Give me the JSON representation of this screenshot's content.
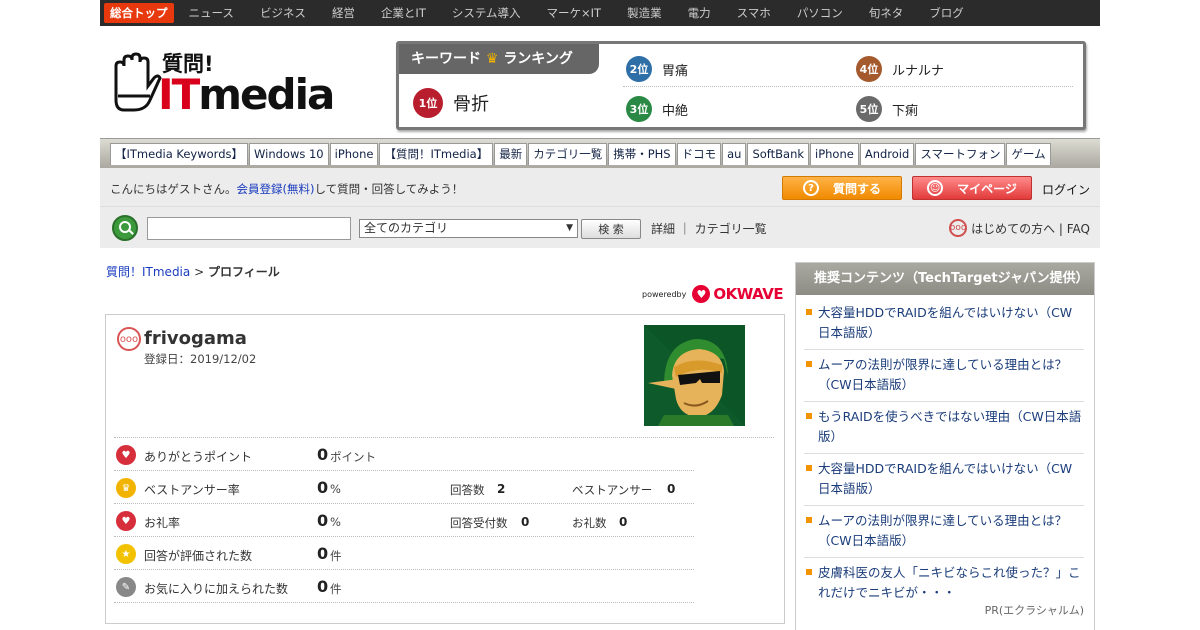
{
  "topnav": {
    "items": [
      "総合トップ",
      "ニュース",
      "ビジネス",
      "経営",
      "企業とIT",
      "システム導入",
      "マーケ×IT",
      "製造業",
      "電力",
      "スマホ",
      "パソコン",
      "旬ネタ",
      "ブログ"
    ]
  },
  "header": {
    "logo_sub": "質問!",
    "logo_it": "IT",
    "logo_media": "media"
  },
  "ranking": {
    "title": "キーワード",
    "crown": "♛",
    "title2": "ランキング",
    "items": [
      {
        "badge": "1位",
        "word": "骨折"
      },
      {
        "badge": "2位",
        "word": "胃痛"
      },
      {
        "badge": "3位",
        "word": "中絶"
      },
      {
        "badge": "4位",
        "word": "ルナルナ"
      },
      {
        "badge": "5位",
        "word": "下痢"
      }
    ]
  },
  "keywords": [
    "【ITmedia Keywords】",
    "Windows 10",
    "iPhone",
    "【質問！ITmedia】",
    "最新",
    "カテゴリ一覧",
    "携帯・PHS",
    "ドコモ",
    "au",
    "SoftBank",
    "iPhone",
    "Android",
    "スマートフォン",
    "ゲーム"
  ],
  "welcome": {
    "pre": "こんにちはゲストさん。",
    "link": "会員登録(無料)",
    "post": "して質問・回答してみよう！",
    "ask": "質問する",
    "mypage": "マイページ",
    "login": "ログイン"
  },
  "search": {
    "placeholder": "",
    "category": "全てのカテゴリ",
    "button": "検 索",
    "links": "詳細 ｜ カテゴリ一覧",
    "help": "はじめての方へ | FAQ"
  },
  "breadcrumb": {
    "home": "質問！ITmedia",
    "sep": " > ",
    "current": "プロフィール"
  },
  "powered": {
    "by": "poweredby",
    "brand": "OKWAVE"
  },
  "profile": {
    "username": "frivogama",
    "registered": "登録日：2019/12/02",
    "stats": [
      {
        "label": "ありがとうポイント",
        "value": "0",
        "unit": "ポイント",
        "sub1_label": "",
        "sub1_value": "",
        "sub2_label": "",
        "sub2_value": ""
      },
      {
        "label": "ベストアンサー率",
        "value": "0",
        "unit": "%",
        "sub1_label": "回答数",
        "sub1_value": "2",
        "sub2_label": "ベストアンサー",
        "sub2_value": "0"
      },
      {
        "label": "お礼率",
        "value": "0",
        "unit": "%",
        "sub1_label": "回答受付数",
        "sub1_value": "0",
        "sub2_label": "お礼数",
        "sub2_value": "0"
      },
      {
        "label": "回答が評価された数",
        "value": "0",
        "unit": "件",
        "sub1_label": "",
        "sub1_value": "",
        "sub2_label": "",
        "sub2_value": ""
      },
      {
        "label": "お気に入りに加えられた数",
        "value": "0",
        "unit": "件",
        "sub1_label": "",
        "sub1_value": "",
        "sub2_label": "",
        "sub2_value": ""
      }
    ]
  },
  "sidebar": {
    "title": "推奨コンテンツ（TechTargetジャパン提供）",
    "entries": [
      "大容量HDDでRAIDを組んではいけない（CW日本語版）",
      "ムーアの法則が限界に達している理由とは？（CW日本語版）",
      "もうRAIDを使うべきではない理由（CW日本語版）",
      "大容量HDDでRAIDを組んではいけない（CW日本語版）",
      "ムーアの法則が限界に達している理由とは？（CW日本語版）",
      "皮膚科医の友人「ニキビならこれ使った？」これだけでニキビが・・・"
    ],
    "pr": "PR(エクラシャルム)"
  },
  "colors": {
    "accent": "#e8390e",
    "link": "#1a3cbf",
    "bullet": "#f29400"
  }
}
